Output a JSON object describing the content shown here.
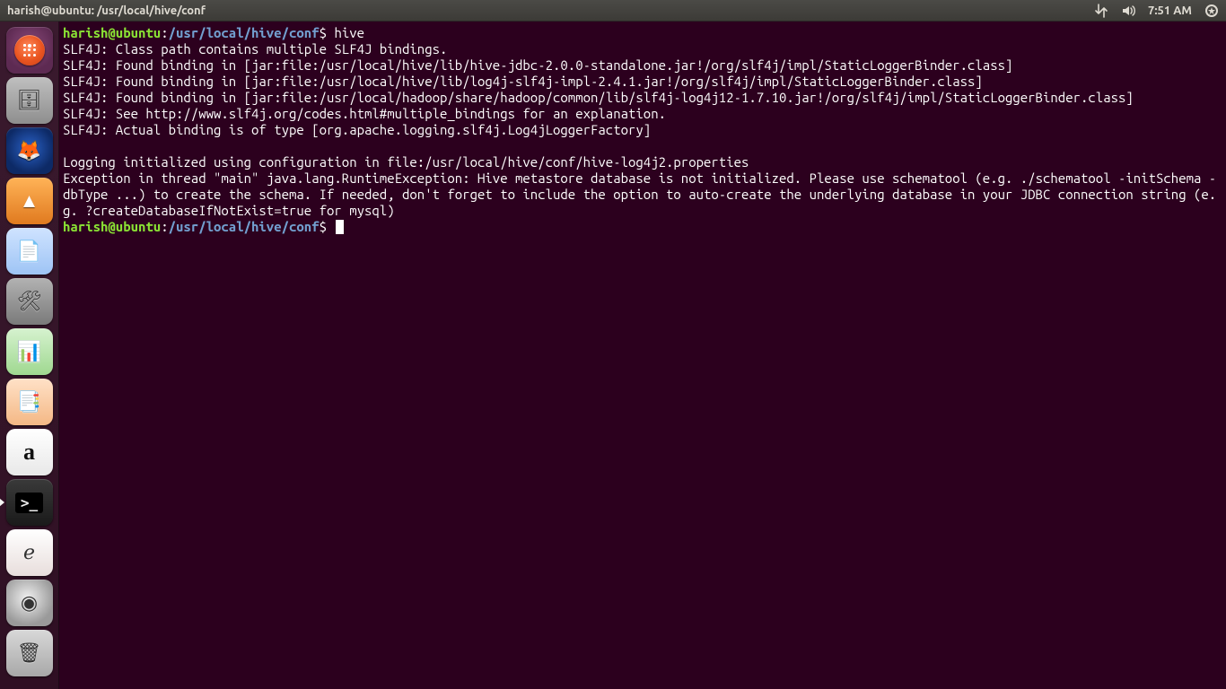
{
  "menubar": {
    "title": "harish@ubuntu: /usr/local/hive/conf",
    "time": "7:51 AM"
  },
  "launcher": {
    "items": [
      {
        "name": "dash-home-icon",
        "glyph": "",
        "cls": "dash",
        "running": false
      },
      {
        "name": "files-icon",
        "glyph": "🗄",
        "cls": "files",
        "running": false
      },
      {
        "name": "firefox-icon",
        "glyph": "🦊",
        "cls": "firefox",
        "running": false
      },
      {
        "name": "vlc-icon",
        "glyph": "▲",
        "cls": "vlc",
        "running": false
      },
      {
        "name": "libreoffice-writer-icon",
        "glyph": "📄",
        "cls": "writer",
        "running": false
      },
      {
        "name": "system-settings-icon",
        "glyph": "🛠",
        "cls": "settings",
        "running": false
      },
      {
        "name": "libreoffice-calc-icon",
        "glyph": "📊",
        "cls": "calc",
        "running": false
      },
      {
        "name": "libreoffice-impress-icon",
        "glyph": "📑",
        "cls": "impress",
        "running": false
      },
      {
        "name": "amazon-icon",
        "glyph": "a",
        "cls": "amazon",
        "running": false
      },
      {
        "name": "terminal-icon",
        "glyph": ">_",
        "cls": "term",
        "running": true
      },
      {
        "name": "document-viewer-icon",
        "glyph": "ℯ",
        "cls": "evince",
        "running": false
      },
      {
        "name": "disc-burner-icon",
        "glyph": "◉",
        "cls": "disc",
        "running": false
      },
      {
        "name": "trash-icon",
        "glyph": "🗑",
        "cls": "trash",
        "running": false
      }
    ]
  },
  "terminal": {
    "prompt": {
      "user_host": "harish@ubuntu",
      "sep": ":",
      "cwd": "/usr/local/hive/conf",
      "sigil": "$"
    },
    "history": [
      {
        "type": "cmd",
        "text": "hive"
      },
      {
        "type": "out",
        "text": "SLF4J: Class path contains multiple SLF4J bindings."
      },
      {
        "type": "out",
        "text": "SLF4J: Found binding in [jar:file:/usr/local/hive/lib/hive-jdbc-2.0.0-standalone.jar!/org/slf4j/impl/StaticLoggerBinder.class]"
      },
      {
        "type": "out",
        "text": "SLF4J: Found binding in [jar:file:/usr/local/hive/lib/log4j-slf4j-impl-2.4.1.jar!/org/slf4j/impl/StaticLoggerBinder.class]"
      },
      {
        "type": "out",
        "text": "SLF4J: Found binding in [jar:file:/usr/local/hadoop/share/hadoop/common/lib/slf4j-log4j12-1.7.10.jar!/org/slf4j/impl/StaticLoggerBinder.class]"
      },
      {
        "type": "out",
        "text": "SLF4J: See http://www.slf4j.org/codes.html#multiple_bindings for an explanation."
      },
      {
        "type": "out",
        "text": "SLF4J: Actual binding is of type [org.apache.logging.slf4j.Log4jLoggerFactory]"
      },
      {
        "type": "out",
        "text": ""
      },
      {
        "type": "out",
        "text": "Logging initialized using configuration in file:/usr/local/hive/conf/hive-log4j2.properties"
      },
      {
        "type": "out",
        "text": "Exception in thread \"main\" java.lang.RuntimeException: Hive metastore database is not initialized. Please use schematool (e.g. ./schematool -initSchema -dbType ...) to create the schema. If needed, don't forget to include the option to auto-create the underlying database in your JDBC connection string (e.g. ?createDatabaseIfNotExist=true for mysql)"
      }
    ]
  }
}
